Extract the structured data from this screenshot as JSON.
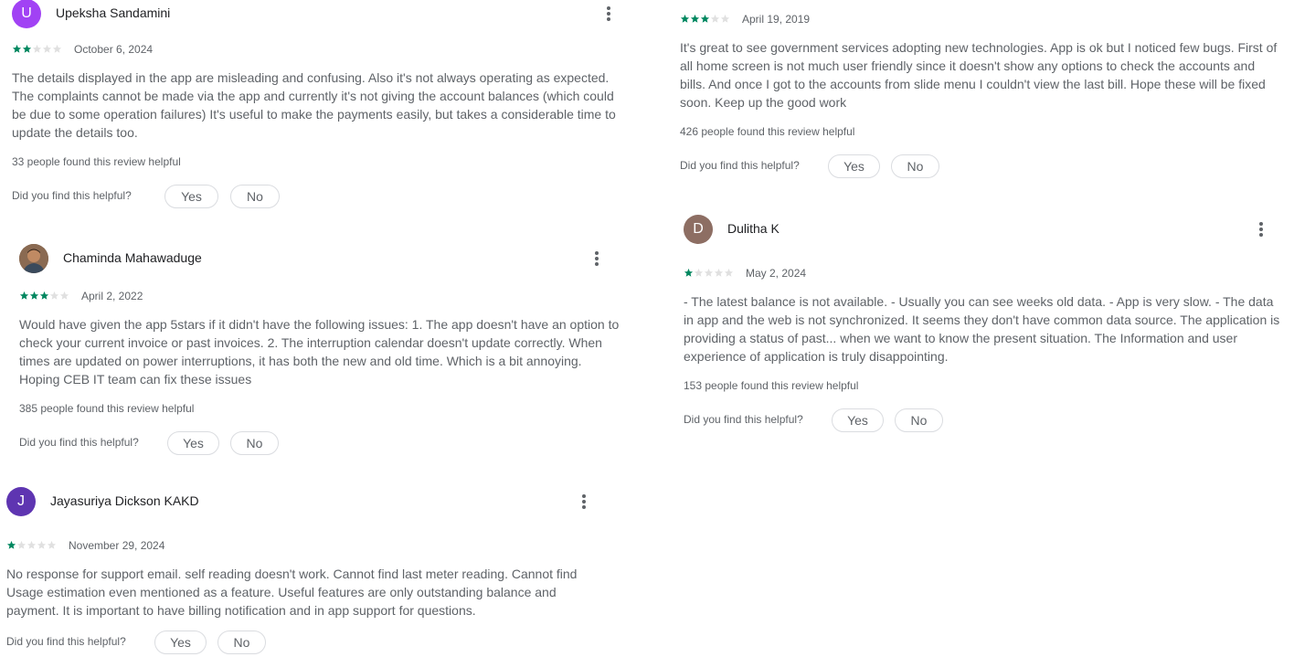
{
  "colors": {
    "star_filled": "#01875f",
    "star_empty": "#e0e0e0"
  },
  "feedback": {
    "question": "Did you find this helpful?",
    "yes": "Yes",
    "no": "No"
  },
  "reviews": [
    {
      "author": "Upeksha Sandamini",
      "initial": "U",
      "avatar_color": "#a142f4",
      "rating": 2,
      "date": "October 6, 2024",
      "text": "The details displayed in the app are misleading and confusing. Also it's not always operating as expected. The complaints cannot be made via the app and currently it's not giving the account balances (which could be due to some operation failures) It's useful to make the payments easily, but takes a considerable time to update the details too.",
      "helpful": "33 people found this review helpful"
    },
    {
      "author": "Chaminda Mahawaduge",
      "initial": "",
      "avatar_color": "#7a5a45",
      "rating": 3,
      "date": "April 2, 2022",
      "text": "Would have given the app 5stars if it didn't have the following issues: 1. The app doesn't have an option to check your current invoice or past invoices. 2. The interruption calendar doesn't update correctly. When times are updated on power interruptions, it has both the new and old time. Which is a bit annoying. Hoping CEB IT team can fix these issues",
      "helpful": "385 people found this review helpful"
    },
    {
      "author": "Jayasuriya Dickson KAKD",
      "initial": "J",
      "avatar_color": "#5e35b1",
      "rating": 1,
      "date": "November 29, 2024",
      "text": "No response for support email. self reading doesn't work. Cannot find last meter reading. Cannot find Usage estimation even mentioned as a feature. Useful features are only outstanding balance and payment. It is important to have billing notification and in app support for questions.",
      "helpful": ""
    },
    {
      "author": "",
      "initial": "",
      "avatar_color": "",
      "rating": 3,
      "date": "April 19, 2019",
      "text": "It's great to see government services adopting new technologies. App is ok but I noticed few bugs. First of all home screen is not much user friendly since it doesn't show any options to check the accounts and bills. And once I got to the accounts from slide menu I couldn't view the last bill. Hope these will be fixed soon. Keep up the good work",
      "helpful": "426 people found this review helpful"
    },
    {
      "author": "Dulitha K",
      "initial": "D",
      "avatar_color": "#8d6e63",
      "rating": 1,
      "date": "May 2, 2024",
      "text": "- The latest balance is not available. - Usually you can see weeks old data. - App is very slow. - The data in app and the web is not synchronized. It seems they don't have common data source. The application is providing a status of past... when we want to know the present situation. The Information and user experience of application is truly disappointing.",
      "helpful": "153 people found this review helpful"
    }
  ]
}
